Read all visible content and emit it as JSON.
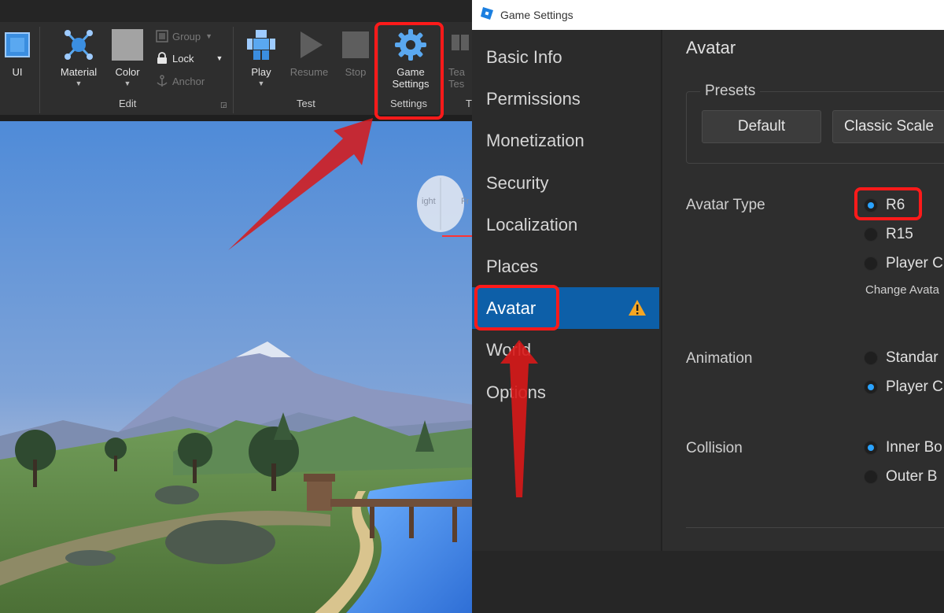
{
  "studio": {
    "toolbar": {
      "ui_label": "UI",
      "material_label": "Material",
      "color_label": "Color",
      "group_label": "Group",
      "lock_label": "Lock",
      "anchor_label": "Anchor",
      "edit_group_title": "Edit",
      "play_label": "Play",
      "resume_label": "Resume",
      "stop_label": "Stop",
      "test_group_title": "Test",
      "game_settings_label_line1": "Game",
      "game_settings_label_line2": "Settings",
      "settings_group_title": "Settings",
      "team_test_label_line1": "Tea",
      "team_test_label_line2": "Tes",
      "team_group_title": "T"
    },
    "viewcube": {
      "face_left": "ight",
      "face_right": "Fr"
    }
  },
  "game_settings": {
    "window_title": "Game Settings",
    "nav_items": [
      {
        "label": "Basic Info"
      },
      {
        "label": "Permissions"
      },
      {
        "label": "Monetization"
      },
      {
        "label": "Security"
      },
      {
        "label": "Localization"
      },
      {
        "label": "Places"
      },
      {
        "label": "Avatar",
        "active": true,
        "warning": true
      },
      {
        "label": "World"
      },
      {
        "label": "Options"
      }
    ],
    "avatar": {
      "heading": "Avatar",
      "presets_label": "Presets",
      "preset_buttons": [
        "Default",
        "Classic Scale"
      ],
      "avatar_type_label": "Avatar Type",
      "avatar_type_options": [
        {
          "label": "R6",
          "selected": true
        },
        {
          "label": "R15",
          "selected": false
        },
        {
          "label": "Player C",
          "selected": false
        }
      ],
      "change_avatar_note": "Change Avata",
      "animation_label": "Animation",
      "animation_options": [
        {
          "label": "Standar",
          "selected": false
        },
        {
          "label": "Player C",
          "selected": true
        }
      ],
      "collision_label": "Collision",
      "collision_options": [
        {
          "label": "Inner Bo",
          "selected": true
        },
        {
          "label": "Outer B",
          "selected": false
        }
      ]
    }
  },
  "colors": {
    "highlight": "#ff1a1a",
    "active_nav": "#0d5fa8",
    "radio_selected": "#2aa3ff",
    "warning": "#f5a623"
  }
}
